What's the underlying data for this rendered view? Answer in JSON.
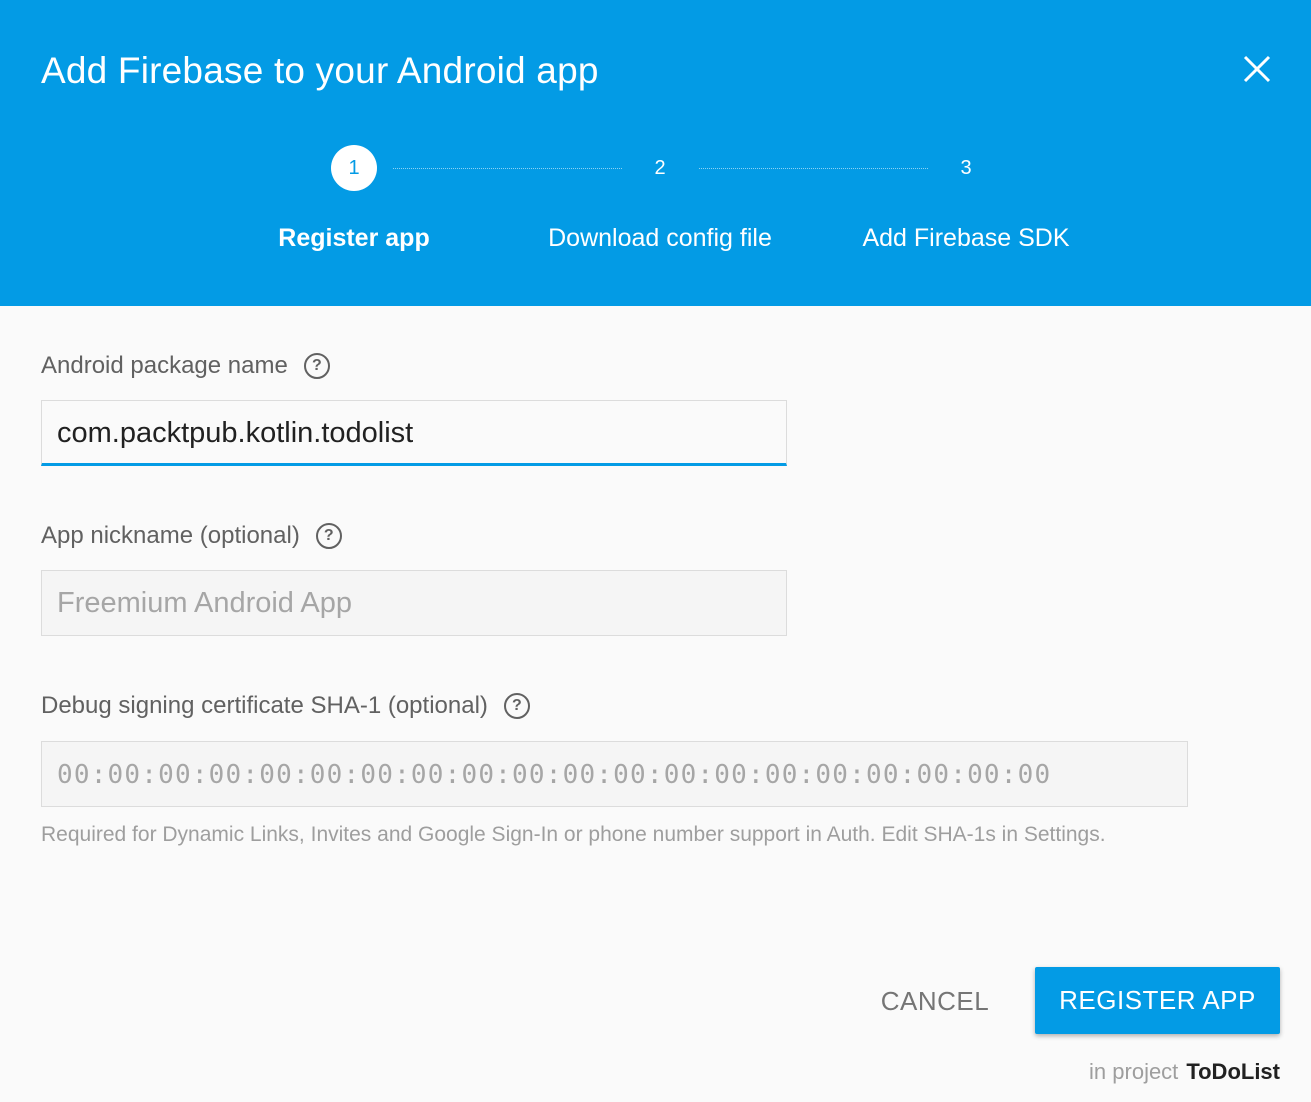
{
  "dialog": {
    "title": "Add Firebase to your Android app",
    "close_icon": "close-icon"
  },
  "stepper": {
    "steps": [
      {
        "number": "1",
        "label": "Register app",
        "active": true
      },
      {
        "number": "2",
        "label": "Download config file",
        "active": false
      },
      {
        "number": "3",
        "label": "Add Firebase SDK",
        "active": false
      }
    ]
  },
  "form": {
    "package_name": {
      "label": "Android package name",
      "value": "com.packtpub.kotlin.todolist",
      "help_icon": "help-icon"
    },
    "nickname": {
      "label": "App nickname (optional)",
      "placeholder": "Freemium Android App",
      "help_icon": "help-icon"
    },
    "sha1": {
      "label": "Debug signing certificate SHA-1 (optional)",
      "placeholder": "00:00:00:00:00:00:00:00:00:00:00:00:00:00:00:00:00:00:00:00",
      "help_icon": "help-icon",
      "hint": "Required for Dynamic Links, Invites and Google Sign-In or phone number support in Auth. Edit SHA-1s in Settings."
    }
  },
  "actions": {
    "cancel_label": "CANCEL",
    "register_label": "REGISTER APP"
  },
  "project": {
    "prefix": "in project",
    "name": "ToDoList"
  },
  "colors": {
    "primary": "#039be5",
    "background": "#fafafa"
  }
}
